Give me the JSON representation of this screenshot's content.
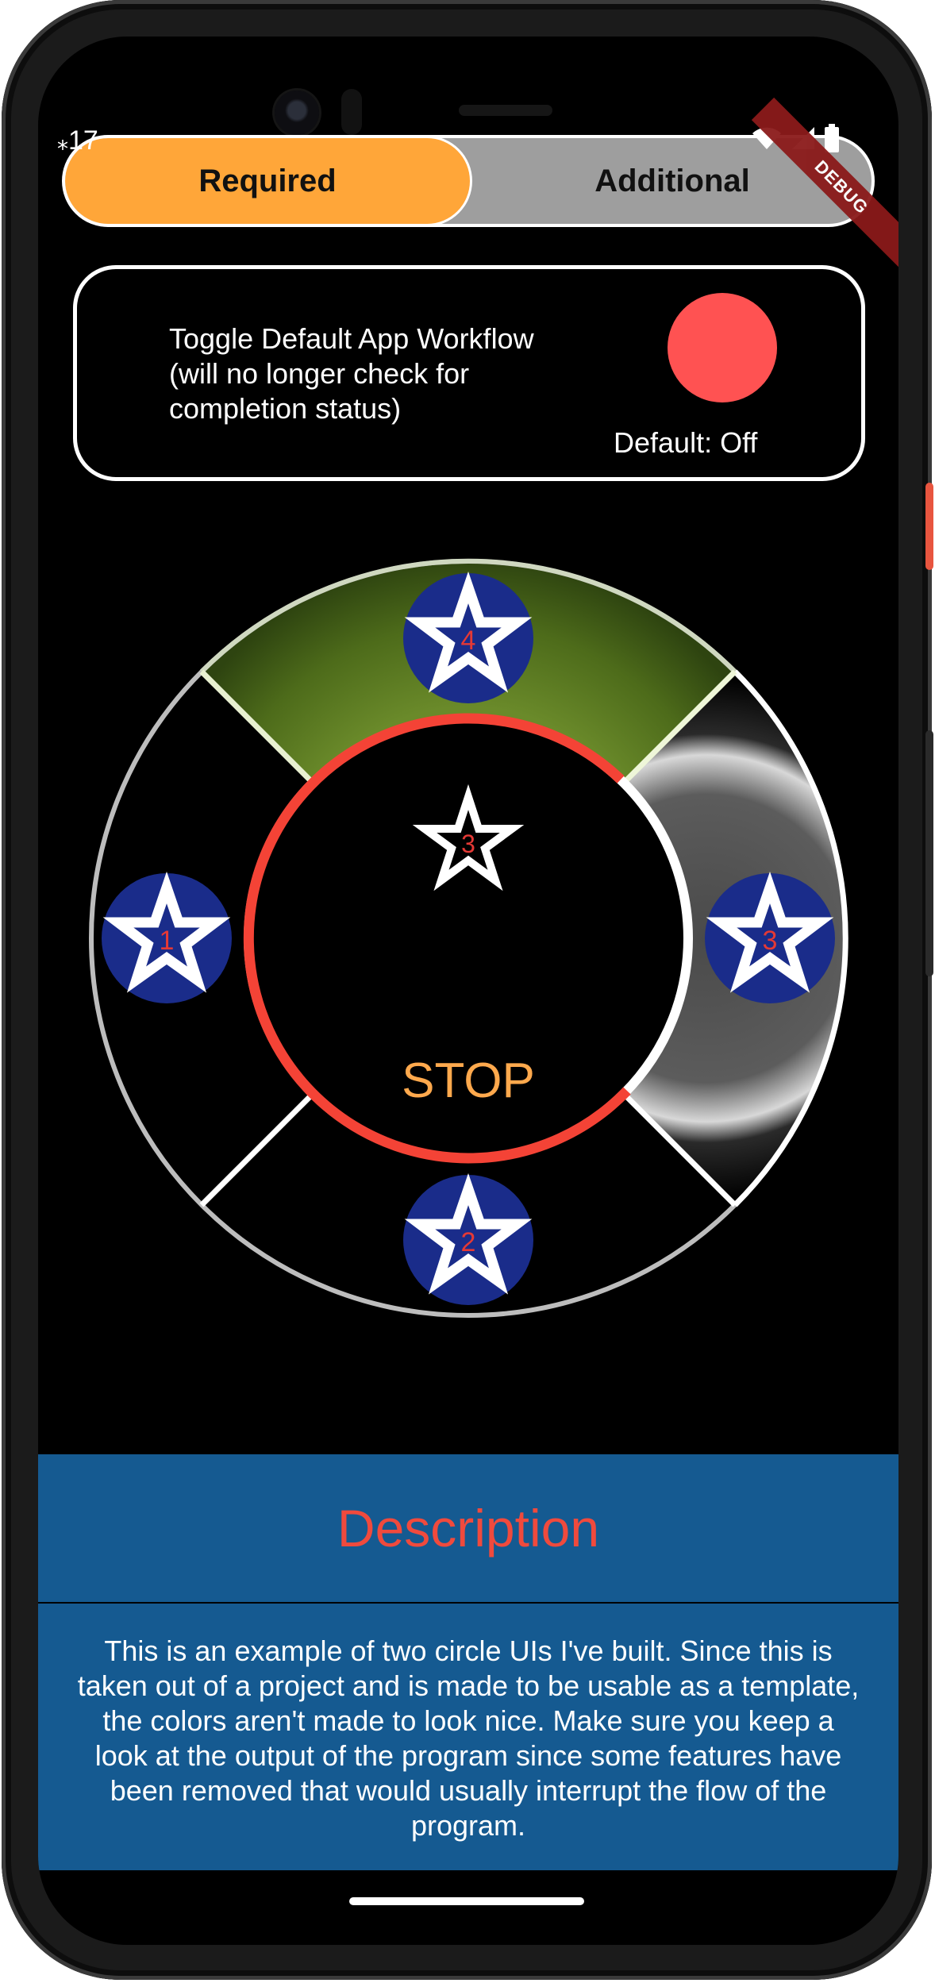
{
  "status_bar": {
    "time": "17"
  },
  "debug_banner": {
    "label": "DEBUG"
  },
  "tabs": [
    {
      "label": "Required",
      "selected": true
    },
    {
      "label": "Additional",
      "selected": false
    }
  ],
  "toggle_card": {
    "description": "Toggle Default App Workflow (will no longer check for completion status)",
    "default_label": "Default: Off",
    "toggle_color": "#ff5252"
  },
  "wheel": {
    "segments": [
      {
        "position": "top",
        "number": "4"
      },
      {
        "position": "left",
        "number": "1"
      },
      {
        "position": "right",
        "number": "3"
      },
      {
        "position": "bottom",
        "number": "2"
      }
    ],
    "center_number": "3",
    "center_label": "STOP",
    "colors": {
      "ring": "#f44336",
      "star_badge": "#1a2c8a",
      "star_number": "#e53935",
      "stop_text": "#ffa94d"
    }
  },
  "description": {
    "title": "Description",
    "body": "This is an example of two circle UIs I've built. Since this is taken out of a project and is made to be usable as a template, the colors aren't made to look nice. Make sure you keep a look at the output of the program since some features have been removed that would usually interrupt the flow of the program."
  }
}
